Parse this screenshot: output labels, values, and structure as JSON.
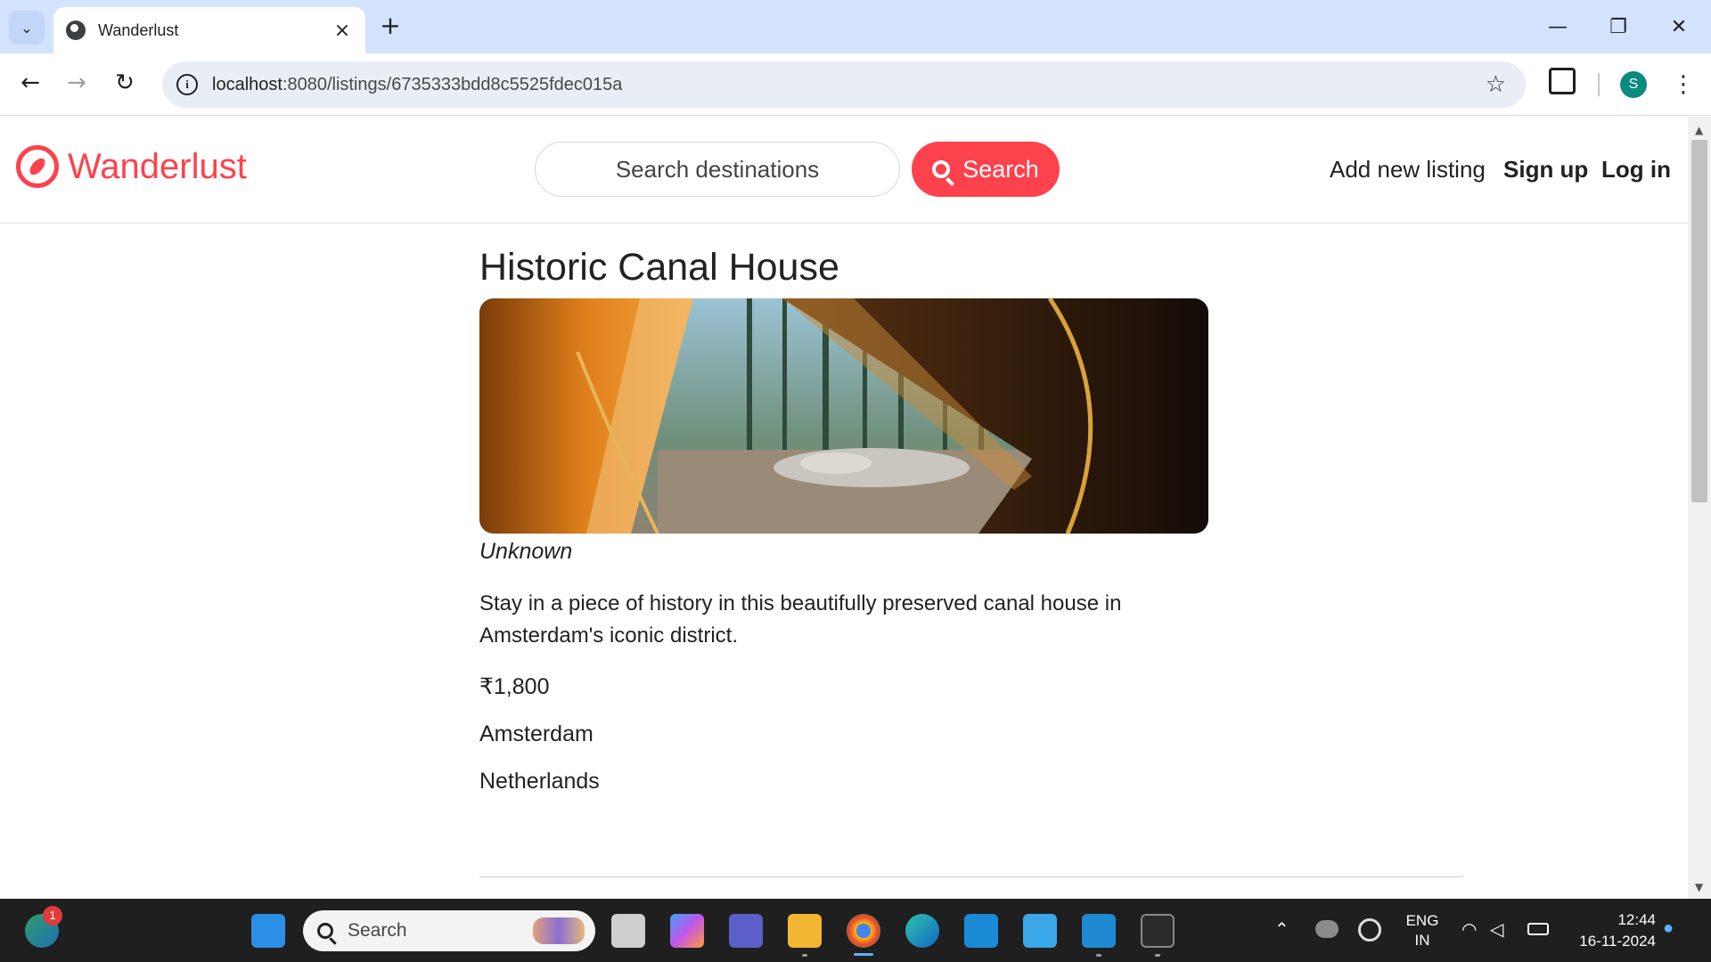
{
  "browser": {
    "tab_title": "Wanderlust",
    "url_host": "localhost",
    "url_rest": ":8080/listings/6735333bdd8c5525fdec015a",
    "profile_initial": "S"
  },
  "site": {
    "brand": "Wanderlust",
    "search_placeholder": "Search destinations",
    "search_button": "Search",
    "nav": {
      "add_listing": "Add new listing",
      "signup": "Sign up",
      "login": "Log in"
    },
    "accent_color": "#fe424d"
  },
  "listing": {
    "title": "Historic Canal House",
    "owner": "Unknown",
    "description": "Stay in a piece of history in this beautifully preserved canal house in Amsterdam's iconic district.",
    "price": "₹1,800",
    "location": "Amsterdam",
    "country": "Netherlands"
  },
  "taskbar": {
    "search_label": "Search",
    "notification_count": "1",
    "lang_line1": "ENG",
    "lang_line2": "IN",
    "time": "12:44",
    "date": "16-11-2024",
    "apps": [
      "start-icon",
      "task-view-icon",
      "copilot-icon",
      "teams-icon",
      "file-explorer-icon",
      "chrome-icon",
      "edge-icon",
      "myhp-icon",
      "notepad-icon",
      "vscode-icon",
      "terminal-icon"
    ]
  }
}
